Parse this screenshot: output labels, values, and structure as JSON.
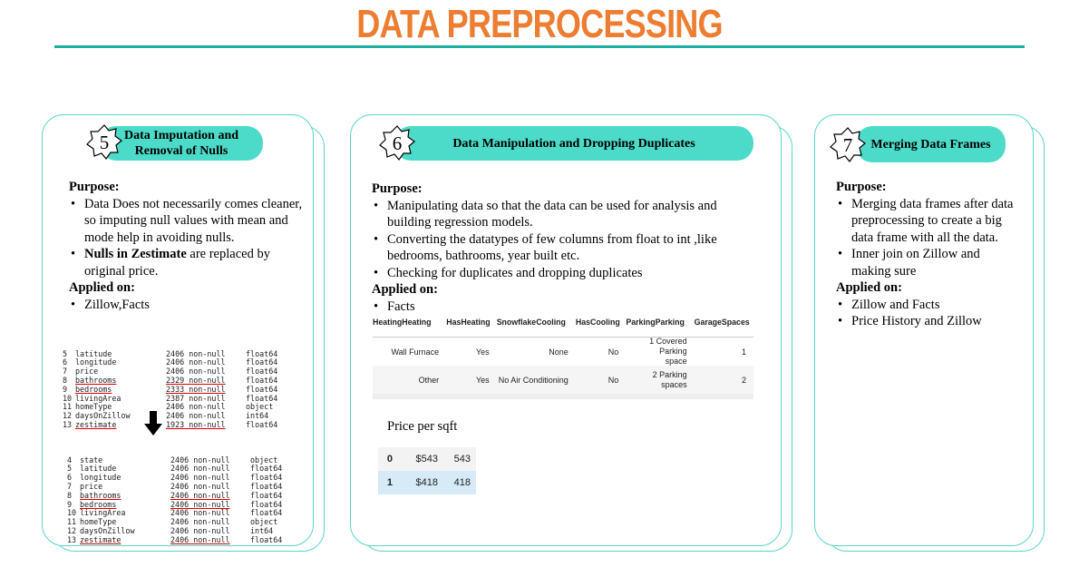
{
  "title": "DATA PREPROCESSING",
  "cards": [
    {
      "number": "5",
      "heading": "Data Imputation and Removal of Nulls",
      "purpose_label": "Purpose:",
      "bullet_1": "Data Does not necessarily comes cleaner, so imputing null values with mean and mode help in avoiding nulls.",
      "bullet_2_bold": "Nulls in Zestimate",
      "bullet_2_rest": " are replaced by original price.",
      "applied_label": "Applied on:",
      "applied_1": "Zillow,Facts"
    },
    {
      "number": "6",
      "heading": "Data Manipulation and Dropping Duplicates",
      "purpose_label": "Purpose:",
      "bullet_1": "Manipulating data so that the data can be used for analysis and building regression models.",
      "bullet_2": "Converting the datatypes of few columns from float to int ,like bedrooms, bathrooms, year built etc.",
      "bullet_3": "Checking for duplicates and dropping duplicates",
      "applied_label": "Applied on:",
      "applied_1": "Facts",
      "price_label": "Price per sqft"
    },
    {
      "number": "7",
      "heading": "Merging Data Frames",
      "purpose_label": "Purpose:",
      "bullet_1": "Merging data frames after data preprocessing to create a big data frame with all the data.",
      "bullet_2": "Inner join on Zillow and making sure",
      "applied_label": "Applied on:",
      "applied_1": "Zillow and Facts",
      "applied_2": "Price History and Zillow"
    }
  ],
  "info_before": [
    [
      "5",
      "latitude",
      "2406",
      "non-null",
      "float64"
    ],
    [
      "6",
      "longitude",
      "2406",
      "non-null",
      "float64"
    ],
    [
      "7",
      "price",
      "2406",
      "non-null",
      "float64"
    ],
    [
      "8",
      "bathrooms",
      "2329",
      "non-null",
      "float64"
    ],
    [
      "9",
      "bedrooms",
      "2333",
      "non-null",
      "float64"
    ],
    [
      "10",
      "livingArea",
      "2387",
      "non-null",
      "float64"
    ],
    [
      "11",
      "homeType",
      "2406",
      "non-null",
      "object"
    ],
    [
      "12",
      "daysOnZillow",
      "2406",
      "non-null",
      "int64"
    ],
    [
      "13",
      "zestimate",
      "1923",
      "non-null",
      "float64"
    ]
  ],
  "info_after": [
    [
      "4",
      "state",
      "2406",
      "non-null",
      "object"
    ],
    [
      "5",
      "latitude",
      "2406",
      "non-null",
      "float64"
    ],
    [
      "6",
      "longitude",
      "2406",
      "non-null",
      "float64"
    ],
    [
      "7",
      "price",
      "2406",
      "non-null",
      "float64"
    ],
    [
      "8",
      "bathrooms",
      "2406",
      "non-null",
      "float64"
    ],
    [
      "9",
      "bedrooms",
      "2406",
      "non-null",
      "float64"
    ],
    [
      "10",
      "livingArea",
      "2406",
      "non-null",
      "float64"
    ],
    [
      "11",
      "homeType",
      "2406",
      "non-null",
      "object"
    ],
    [
      "12",
      "daysOnZillow",
      "2406",
      "non-null",
      "int64"
    ],
    [
      "13",
      "zestimate",
      "2406",
      "non-null",
      "float64"
    ]
  ],
  "facts_table": {
    "headers": [
      "HeatingHeating",
      "HasHeating",
      "SnowflakeCooling",
      "HasCooling",
      "ParkingParking",
      "GarageSpaces"
    ],
    "rows": [
      [
        "Wall Furnace",
        "Yes",
        "None",
        "No",
        "1 Covered Parking space",
        "1"
      ],
      [
        "Other",
        "Yes",
        "No Air Conditioning",
        "No",
        "2 Parking spaces",
        "2"
      ]
    ]
  },
  "price_table": {
    "rows": [
      [
        "0",
        "$543",
        "543"
      ],
      [
        "1",
        "$418",
        "418"
      ]
    ]
  },
  "colors": {
    "title": "#ED7D31",
    "accent": "#4DDBC9",
    "border": "#58D6C8",
    "rule": "#1AB0A0"
  }
}
